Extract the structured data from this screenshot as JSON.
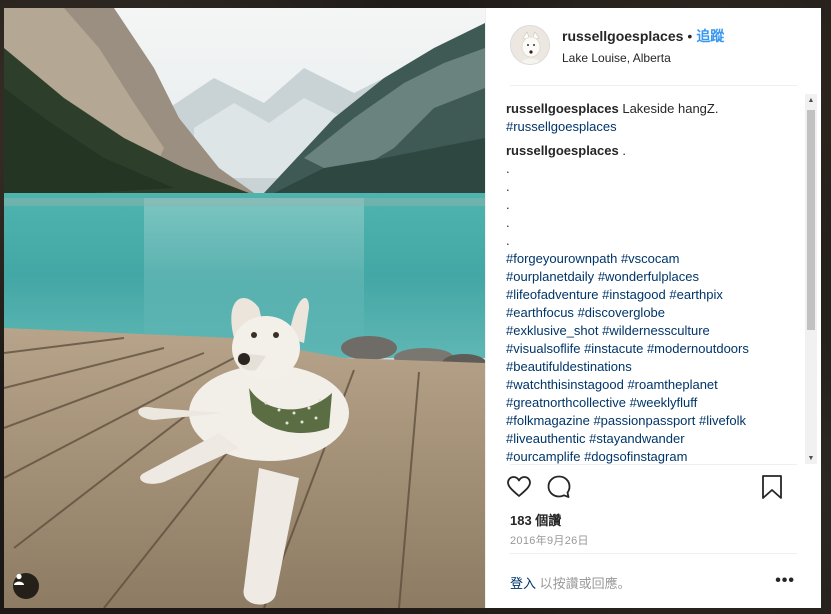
{
  "post": {
    "username": "russellgoesplaces",
    "separator": "•",
    "follow_label": "追蹤",
    "location": "Lake Louise, Alberta"
  },
  "caption": {
    "username": "russellgoesplaces",
    "text": " Lakeside hangZ.",
    "hashtag": "#russellgoesplaces"
  },
  "second_comment": {
    "username": "russellgoesplaces",
    "text": " .",
    "dots": [
      ".",
      ".",
      ".",
      ".",
      "."
    ],
    "hashtag_lines": [
      [
        "#forgeyourownpath",
        "#vscocam"
      ],
      [
        "#ourplanetdaily",
        "#wonderfulplaces"
      ],
      [
        "#lifeofadventure",
        "#instagood",
        "#earthpix"
      ],
      [
        "#earthfocus",
        "#discoverglobe"
      ],
      [
        "#exklusive_shot",
        "#wildernessculture"
      ],
      [
        "#visualsoflife",
        "#instacute",
        "#modernoutdoors"
      ],
      [
        "#beautifuldestinations"
      ],
      [
        "#watchthisinstagood",
        "#roamtheplanet"
      ],
      [
        "#greatnorthcollective",
        "#weeklyfluff"
      ],
      [
        "#folkmagazine",
        "#passionpassport",
        "#livefolk"
      ],
      [
        "#liveauthentic",
        "#stayandwander"
      ],
      [
        "#ourcamplife",
        "#dogsofinstagram"
      ]
    ]
  },
  "stats": {
    "views": "183 個讚",
    "date": "2016年9月26日"
  },
  "footer": {
    "login_link": "登入",
    "login_text": "以按讚或回應。",
    "more": "•••"
  },
  "icons": {
    "like": "heart-icon",
    "comment": "comment-icon",
    "save": "bookmark-icon",
    "tag": "person-tag-icon"
  },
  "colors": {
    "link_blue": "#3897f0",
    "hashtag": "#003569",
    "muted": "#999999"
  }
}
